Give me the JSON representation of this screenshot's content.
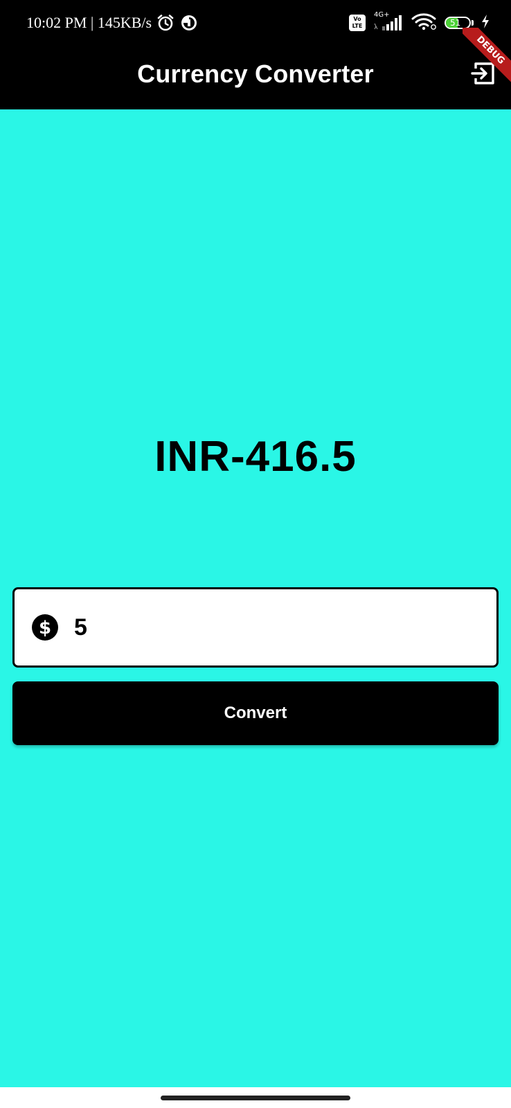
{
  "status_bar": {
    "time_speed": "10:02 PM | 145KB/s",
    "network_type": "4G+",
    "volte_top": "Vo",
    "volte_bottom": "LTE",
    "battery_level": "51",
    "battery_fraction": 0.51,
    "icons": [
      "alarm-icon",
      "sync-icon",
      "volte-icon",
      "signal-icon",
      "wifi-icon",
      "battery-icon",
      "charging-icon"
    ]
  },
  "app_bar": {
    "title": "Currency Converter",
    "action_icon": "logout-icon",
    "debug_banner": "DEBUG"
  },
  "main": {
    "result_text": "INR-416.5",
    "amount_input": {
      "value": "5",
      "prefix_icon": "dollar-icon"
    },
    "convert_label": "Convert"
  },
  "colors": {
    "background": "#2af6e6",
    "app_bar": "#000000",
    "button": "#000000",
    "button_text": "#ffffff",
    "debug_ribbon": "#b71c1c"
  }
}
